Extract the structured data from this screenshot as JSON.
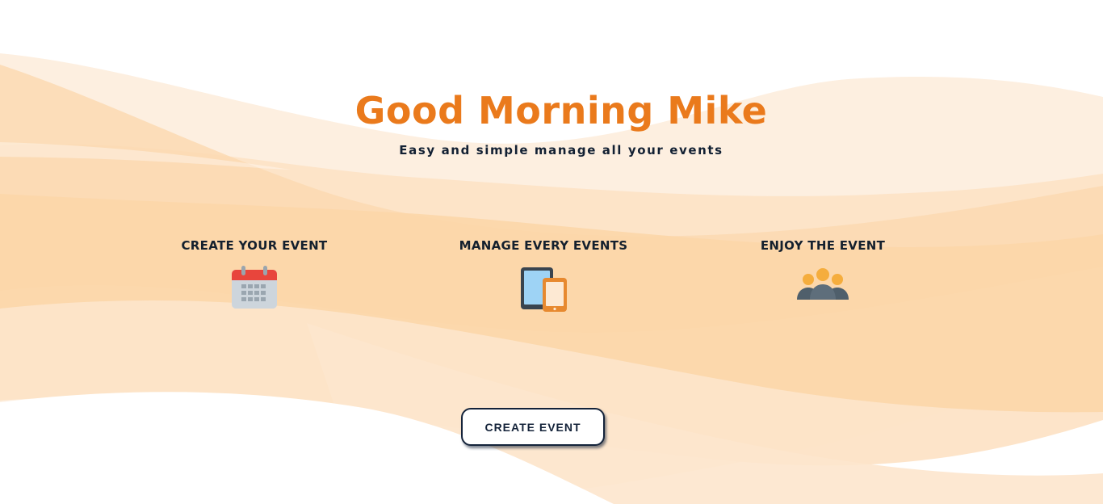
{
  "hero": {
    "greeting": "Good Morning Mike",
    "tagline": "Easy and simple manage all your events"
  },
  "features": [
    {
      "title": "CREATE YOUR EVENT",
      "icon": "calendar-icon"
    },
    {
      "title": "MANAGE EVERY EVENTS",
      "icon": "devices-icon"
    },
    {
      "title": "ENJOY THE EVENT",
      "icon": "people-group-icon"
    }
  ],
  "cta": {
    "label": "CREATE EVENT"
  },
  "colors": {
    "accent": "#ea7a1c",
    "text_dark": "#14202e",
    "wave_light": "#fdeedd",
    "wave_mid": "#fbdcb8",
    "wave_strong": "#f9c990"
  }
}
